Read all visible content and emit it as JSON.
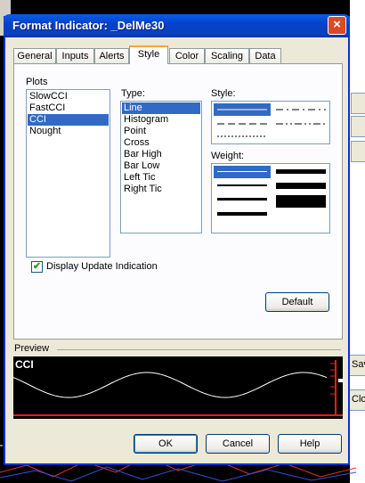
{
  "window": {
    "title": "Format Indicator: _DelMe30",
    "close_glyph": "×"
  },
  "background_app": {
    "fragments": [
      "Sav",
      "Clos"
    ]
  },
  "tabs": [
    {
      "label": "General"
    },
    {
      "label": "Inputs"
    },
    {
      "label": "Alerts"
    },
    {
      "label": "Style",
      "active": true
    },
    {
      "label": "Color"
    },
    {
      "label": "Scaling"
    },
    {
      "label": "Data"
    }
  ],
  "plots": {
    "label": "Plots",
    "items": [
      "SlowCCI",
      "FastCCI",
      "CCI",
      "Nought"
    ],
    "selected": "CCI"
  },
  "type": {
    "label": "Type:",
    "items": [
      "Line",
      "Histogram",
      "Point",
      "Cross",
      "Bar High",
      "Bar Low",
      "Left Tic",
      "Right Tic"
    ],
    "selected": "Line"
  },
  "style": {
    "label": "Style:",
    "options": [
      "solid",
      "dash-dot",
      "dash",
      "dash-dot-dot",
      "dot"
    ],
    "selected": "solid"
  },
  "weight": {
    "label": "Weight:",
    "options": [
      1,
      2,
      3,
      4,
      5,
      6,
      7
    ],
    "selected": 1
  },
  "display_update": {
    "label": "Display Update Indication",
    "checked": true,
    "check_glyph": "✔"
  },
  "buttons": {
    "default": "Default",
    "ok": "OK",
    "cancel": "Cancel",
    "help": "Help"
  },
  "preview": {
    "label": "Preview",
    "plot_name": "CCI",
    "line_color": "#ffffff",
    "zero_line_color": "#e0201c"
  },
  "colors": {
    "selection": "#316ac5",
    "title_bar": "#0442c9"
  }
}
